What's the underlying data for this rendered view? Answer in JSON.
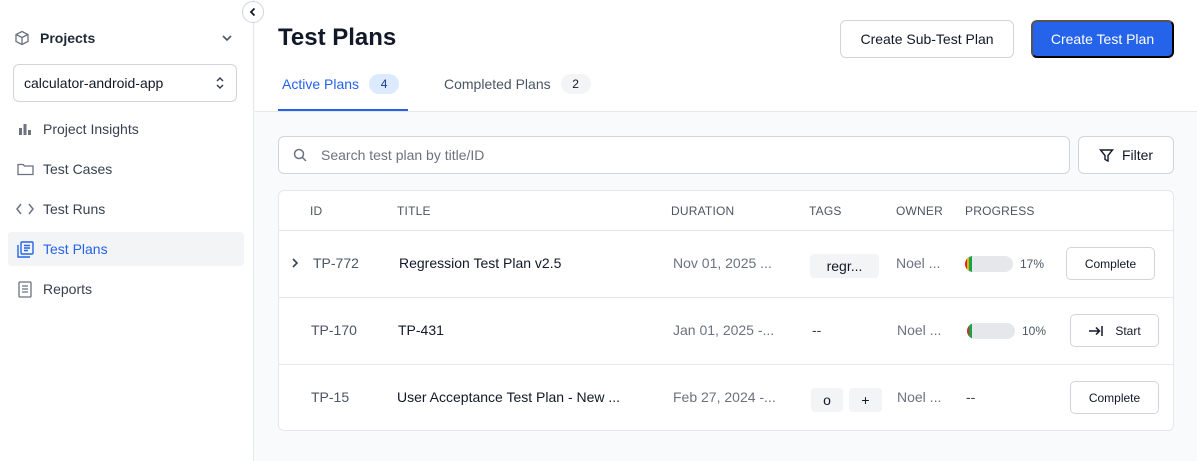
{
  "sidebar": {
    "projects_label": "Projects",
    "project_selected": "calculator-android-app",
    "items": [
      {
        "label": "Project Insights",
        "icon": "bar-chart-icon",
        "active": false
      },
      {
        "label": "Test Cases",
        "icon": "folder-icon",
        "active": false
      },
      {
        "label": "Test Runs",
        "icon": "code-icon",
        "active": false
      },
      {
        "label": "Test Plans",
        "icon": "test-plans-icon",
        "active": true
      },
      {
        "label": "Reports",
        "icon": "report-icon",
        "active": false
      }
    ]
  },
  "header": {
    "title": "Test Plans",
    "create_sub_label": "Create Sub-Test Plan",
    "create_label": "Create Test Plan",
    "tabs": [
      {
        "label": "Active Plans",
        "count": "4"
      },
      {
        "label": "Completed Plans",
        "count": "2"
      }
    ]
  },
  "search": {
    "placeholder": "Search test plan by title/ID"
  },
  "filter_label": "Filter",
  "table": {
    "columns": [
      "ID",
      "TITLE",
      "DURATION",
      "TAGS",
      "OWNER",
      "PROGRESS"
    ],
    "rows": [
      {
        "id": "TP-772",
        "title": "Regression Test Plan v2.5",
        "duration": "Nov 01, 2025 ...",
        "tags": [
          "regr..."
        ],
        "owner": "Noel ...",
        "progress_pct": 17,
        "progress_text": "17%",
        "action": "Complete"
      },
      {
        "id": "TP-170",
        "title": "TP-431",
        "duration": "Jan 01, 2025 -...",
        "tags_text": "--",
        "owner": "Noel ...",
        "progress_pct": 10,
        "progress_text": "10%",
        "action": "Start"
      },
      {
        "id": "TP-15",
        "title": "User Acceptance Test Plan - New ...",
        "duration": "Feb 27, 2024 -...",
        "tags": [
          "o",
          "+"
        ],
        "owner": "Noel ...",
        "progress_text": "--",
        "action": "Complete"
      }
    ]
  },
  "colors": {
    "accent": "#2563eb",
    "progress_green": "#16a34a",
    "progress_red": "#dc2626",
    "progress_yellow": "#eab308"
  }
}
